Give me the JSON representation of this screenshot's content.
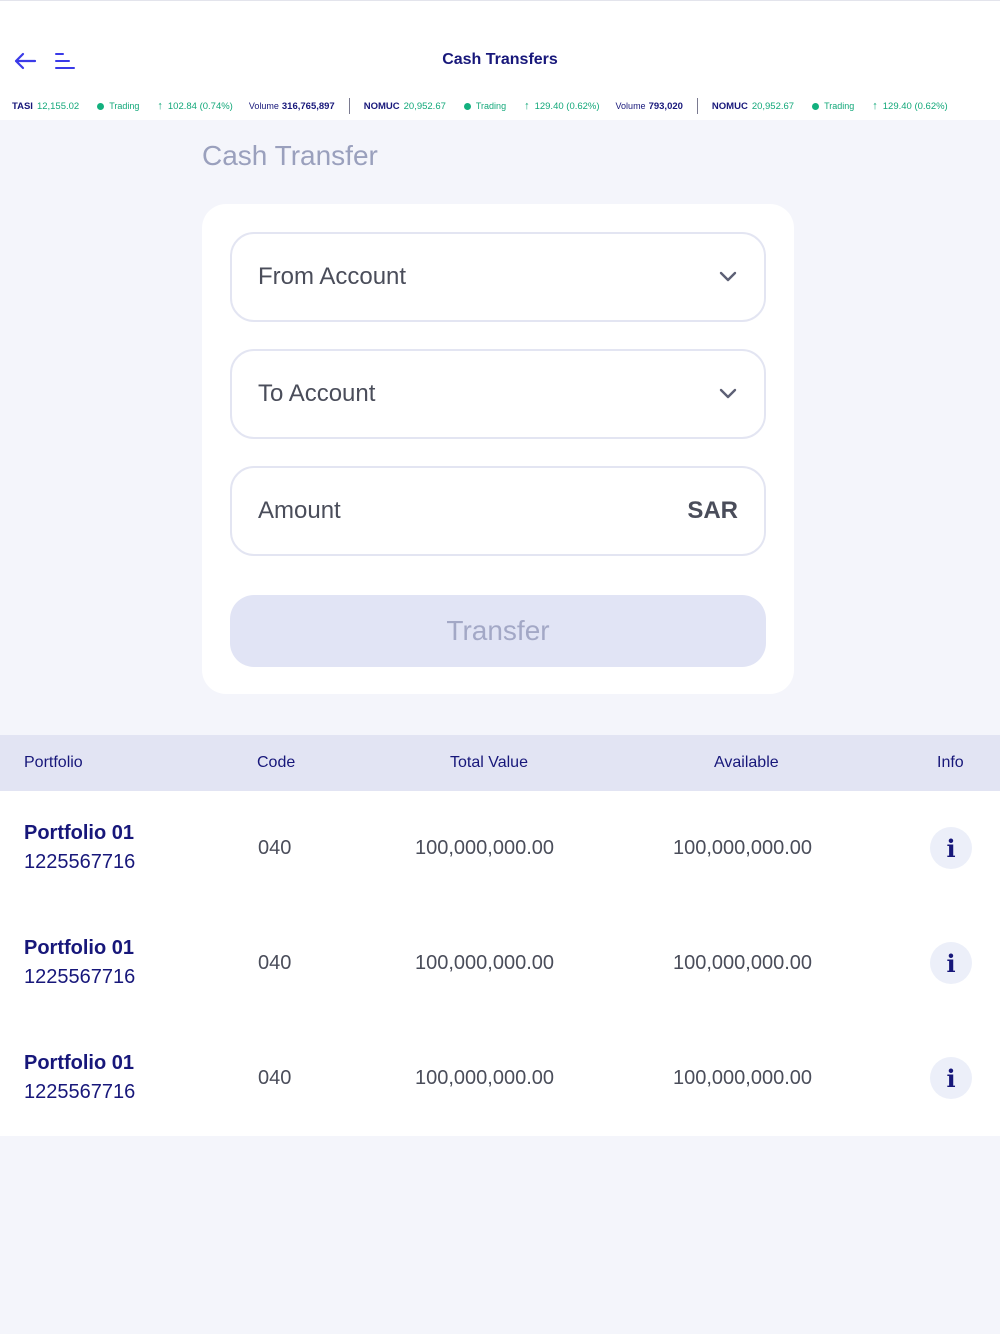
{
  "header": {
    "title": "Cash Transfers"
  },
  "ticker": [
    {
      "name": "TASI",
      "value": "12,155.02",
      "status": "Trading",
      "change": "102.84 (0.74%)",
      "volume_label": "Volume",
      "volume": "316,765,897"
    },
    {
      "name": "NOMUC",
      "value": "20,952.67",
      "status": "Trading",
      "change": "129.40 (0.62%)",
      "volume_label": "Volume",
      "volume": "793,020"
    },
    {
      "name": "NOMUC",
      "value": "20,952.67",
      "status": "Trading",
      "change": "129.40 (0.62%)"
    }
  ],
  "form": {
    "title": "Cash Transfer",
    "from_account": "From Account",
    "to_account": "To Account",
    "amount": "Amount",
    "currency": "SAR",
    "transfer_label": "Transfer"
  },
  "table": {
    "headers": [
      "Portfolio",
      "Code",
      "Total Value",
      "Available",
      "Info"
    ],
    "rows": [
      {
        "name": "Portfolio 01",
        "number": "1225567716",
        "code": "040",
        "total": "100,000,000.00",
        "available": "100,000,000.00"
      },
      {
        "name": "Portfolio 01",
        "number": "1225567716",
        "code": "040",
        "total": "100,000,000.00",
        "available": "100,000,000.00"
      },
      {
        "name": "Portfolio 01",
        "number": "1225567716",
        "code": "040",
        "total": "100,000,000.00",
        "available": "100,000,000.00"
      }
    ]
  },
  "icons": {
    "back": "arrow-left-icon",
    "menu": "menu-icon",
    "dropdown": "chevron-down-icon",
    "info": "info-icon",
    "up": "arrow-up-icon",
    "status": "status-dot-icon"
  },
  "colors": {
    "brand": "#17177a",
    "accent": "#3a3ae8",
    "positive": "#13a87a",
    "disabled_button": "#e1e4f5"
  }
}
